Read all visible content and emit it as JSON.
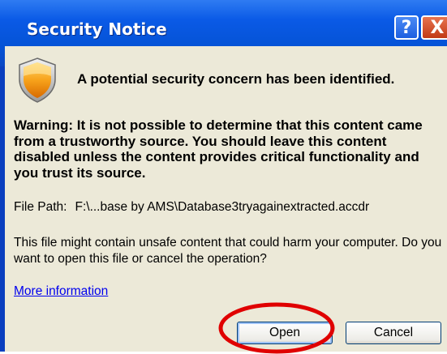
{
  "dialog": {
    "title": "Security Notice",
    "help_button": "?",
    "close_button": "X",
    "headline": "A potential security concern has been identified.",
    "warning": "Warning: It is not possible to determine that this content came from a trustworthy source. You should leave this content disabled unless the content provides critical functionality and you trust its source.",
    "file_path_label": "File Path:",
    "file_path_value": "F:\\...base by AMS\\Database3tryagainextracted.accdr",
    "unsafe_message": "This file might contain unsafe content that could harm your computer. Do you want to open this file or cancel the operation?",
    "more_info_link": "More information",
    "open_button": "Open",
    "cancel_button": "Cancel"
  },
  "colors": {
    "titlebar": "#0553d6",
    "client_bg": "#ece9d8",
    "link": "#0000ee",
    "highlight": "#e00000"
  },
  "icons": {
    "shield": "security-shield-icon"
  }
}
